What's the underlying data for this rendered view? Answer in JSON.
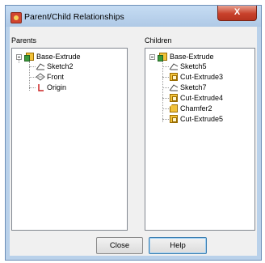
{
  "window": {
    "title": "Parent/Child Relationships",
    "close_glyph": "X"
  },
  "parents": {
    "label": "Parents",
    "root": {
      "label": "Base-Extrude",
      "icon": "base-extrude-icon"
    },
    "children": [
      {
        "label": "Sketch2",
        "icon": "sketch-icon"
      },
      {
        "label": "Front",
        "icon": "plane-icon"
      },
      {
        "label": "Origin",
        "icon": "origin-icon"
      }
    ]
  },
  "children": {
    "label": "Children",
    "root": {
      "label": "Base-Extrude",
      "icon": "base-extrude-icon"
    },
    "items": [
      {
        "label": "Sketch5",
        "icon": "sketch-icon"
      },
      {
        "label": "Cut-Extrude3",
        "icon": "cut-extrude-icon"
      },
      {
        "label": "Sketch7",
        "icon": "sketch-icon"
      },
      {
        "label": "Cut-Extrude4",
        "icon": "cut-extrude-icon"
      },
      {
        "label": "Chamfer2",
        "icon": "chamfer-icon"
      },
      {
        "label": "Cut-Extrude5",
        "icon": "cut-extrude-icon"
      }
    ]
  },
  "buttons": {
    "close": "Close",
    "help": "Help"
  },
  "colors": {
    "title_bar": "#b9d1ea",
    "close_button": "#c8412b",
    "feature_icon": "#f2c23a"
  }
}
